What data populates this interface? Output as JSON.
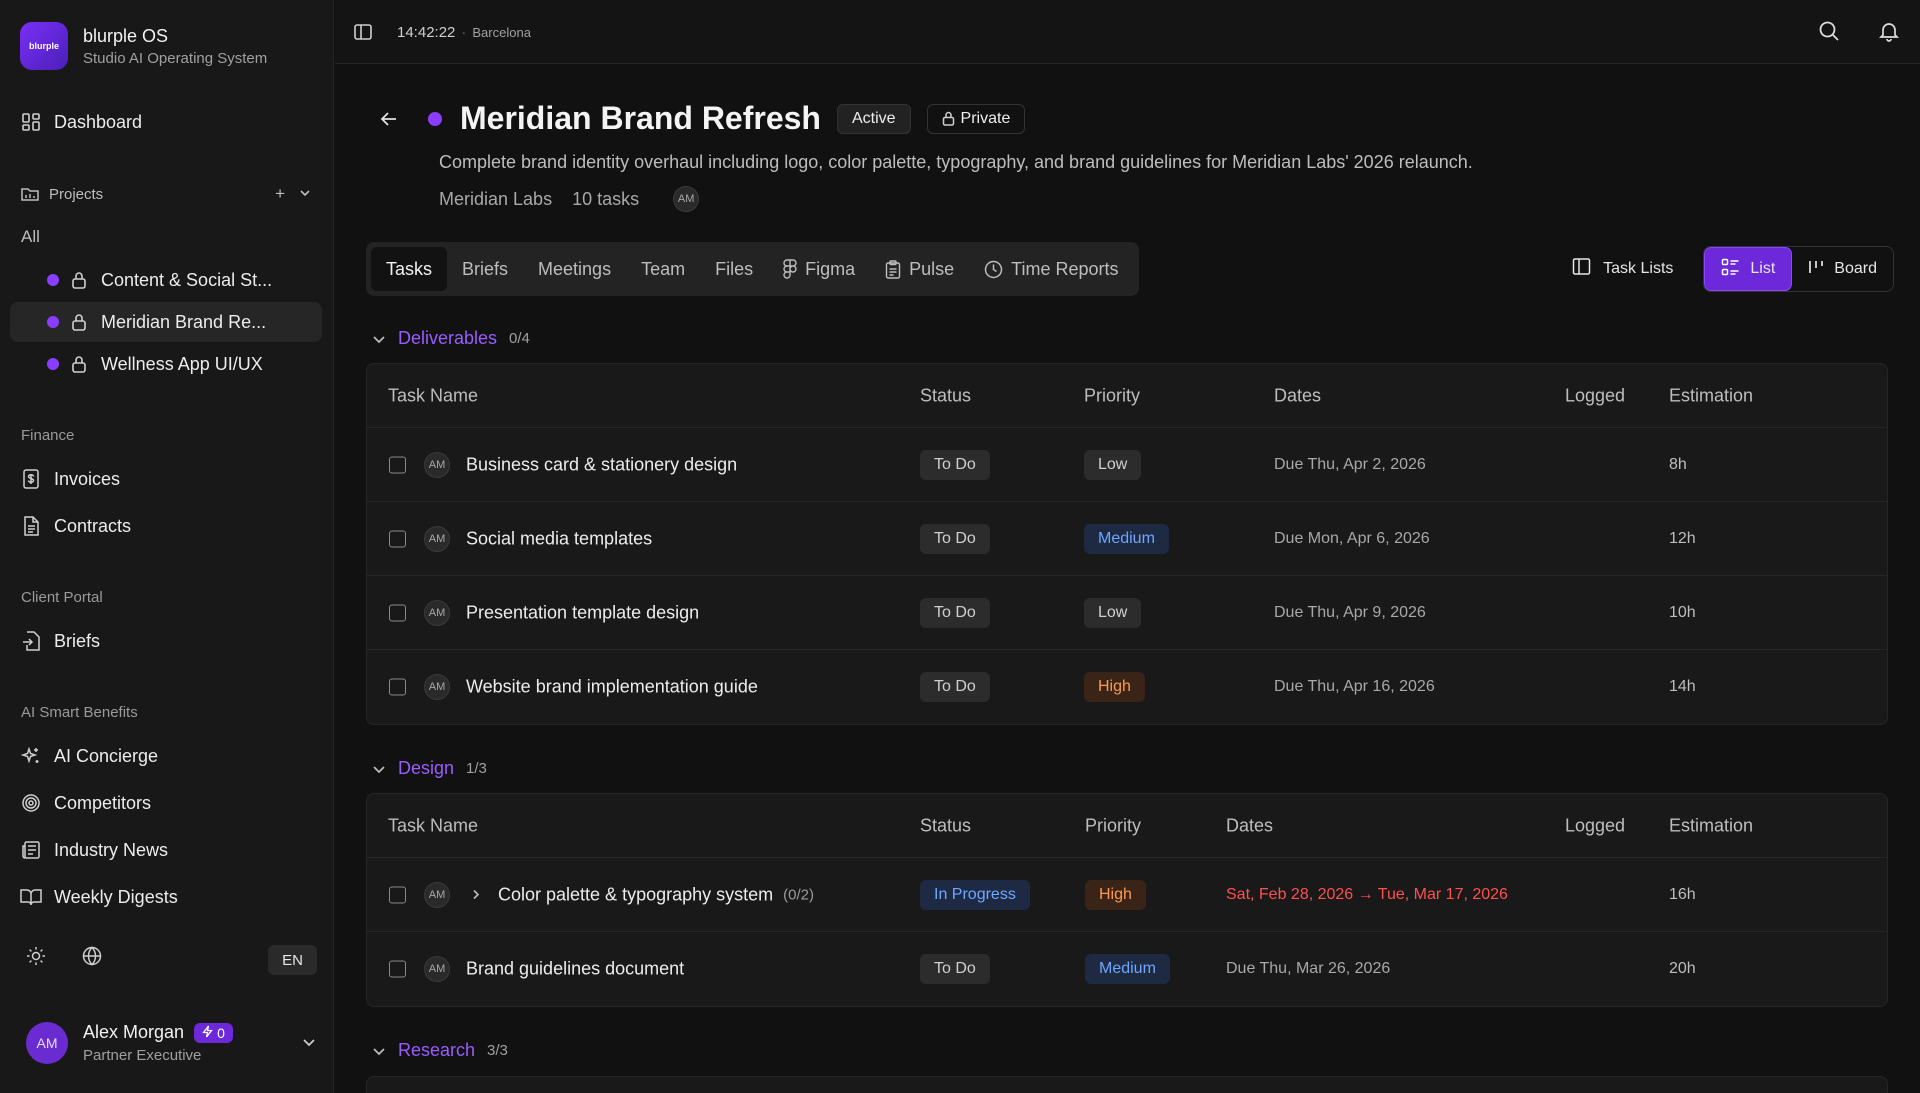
{
  "app": {
    "name": "blurple OS",
    "subtitle": "Studio AI Operating System",
    "logo_text": "blurple"
  },
  "sidebar": {
    "dashboard": "Dashboard",
    "projects_label": "Projects",
    "projects_all": "All",
    "projects": [
      {
        "name": "Content & Social St..."
      },
      {
        "name": "Meridian Brand Re..."
      },
      {
        "name": "Wellness App UI/UX"
      }
    ],
    "finance_label": "Finance",
    "finance": [
      "Invoices",
      "Contracts"
    ],
    "client_portal_label": "Client Portal",
    "client_portal": [
      "Briefs"
    ],
    "ai_label": "AI Smart Benefits",
    "ai": [
      "AI Concierge",
      "Competitors",
      "Industry News",
      "Weekly Digests"
    ],
    "lang": "EN",
    "user": {
      "initials": "AM",
      "name": "Alex Morgan",
      "credits": "0",
      "role": "Partner Executive"
    }
  },
  "topbar": {
    "time": "14:42:22",
    "sep": "·",
    "city": "Barcelona"
  },
  "project": {
    "title": "Meridian Brand Refresh",
    "status": "Active",
    "visibility": "Private",
    "description": "Complete brand identity overhaul including logo, color palette, typography, and brand guidelines for Meridian Labs' 2026 relaunch.",
    "client": "Meridian Labs",
    "task_count": "10 tasks",
    "member_initials": "AM"
  },
  "tabs": [
    "Tasks",
    "Briefs",
    "Meetings",
    "Team",
    "Files",
    "Figma",
    "Pulse",
    "Time Reports"
  ],
  "views": {
    "task_lists": "Task Lists",
    "list": "List",
    "board": "Board"
  },
  "columns": {
    "task": "Task Name",
    "status": "Status",
    "priority": "Priority",
    "dates": "Dates",
    "logged": "Logged",
    "estimation": "Estimation"
  },
  "groups": [
    {
      "name": "Deliverables",
      "count": "0/4",
      "tasks": [
        {
          "initials": "AM",
          "name": "Business card & stationery design",
          "status": "To Do",
          "priority": "Low",
          "date": "Due Thu, Apr 2, 2026",
          "logged": "",
          "estimation": "8h"
        },
        {
          "initials": "AM",
          "name": "Social media templates",
          "status": "To Do",
          "priority": "Medium",
          "date": "Due Mon, Apr 6, 2026",
          "logged": "",
          "estimation": "12h"
        },
        {
          "initials": "AM",
          "name": "Presentation template design",
          "status": "To Do",
          "priority": "Low",
          "date": "Due Thu, Apr 9, 2026",
          "logged": "",
          "estimation": "10h"
        },
        {
          "initials": "AM",
          "name": "Website brand implementation guide",
          "status": "To Do",
          "priority": "High",
          "date": "Due Thu, Apr 16, 2026",
          "logged": "",
          "estimation": "14h"
        }
      ]
    },
    {
      "name": "Design",
      "count": "1/3",
      "tasks": [
        {
          "initials": "AM",
          "name": "Color palette & typography system",
          "subtasks": "(0/2)",
          "status": "In Progress",
          "priority": "High",
          "date": "Sat, Feb 28, 2026 → Tue, Mar 17, 2026",
          "logged": "",
          "estimation": "16h"
        },
        {
          "initials": "AM",
          "name": "Brand guidelines document",
          "status": "To Do",
          "priority": "Medium",
          "date": "Due Thu, Mar 26, 2026",
          "logged": "",
          "estimation": "20h"
        }
      ]
    },
    {
      "name": "Research",
      "count": "3/3"
    }
  ],
  "colors": {
    "accent": "#6d28d9",
    "accent_text": "#9b5cff",
    "overdue": "#ff4f4f",
    "high": "#ff9a4d",
    "medium": "#6fa5ff"
  }
}
